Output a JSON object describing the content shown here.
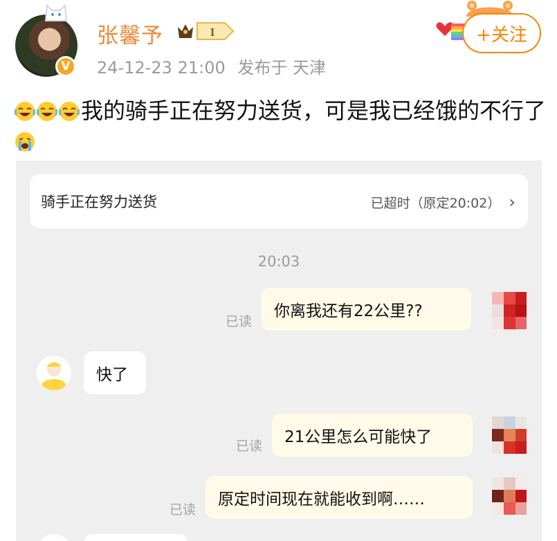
{
  "post": {
    "username": "张馨予",
    "member_level": "I",
    "timestamp": "24-12-23 21:00",
    "location": "发布于 天津",
    "follow_label": "+关注",
    "text": "我的骑手正在努力送货，可是我已经饿的不行了",
    "verified_mark": "V",
    "leading_emojis": [
      "laughing-crying-emoji",
      "laughing-crying-emoji",
      "laughing-crying-emoji"
    ],
    "trailing_emoji": "loud-crying-emoji",
    "colors": {
      "username": "#ee8a3a",
      "follow": "#ff8200",
      "meta": "#9a9a9a"
    }
  },
  "chat": {
    "status_title": "骑手正在努力送货",
    "status_detail": "已超时（原定20:02）",
    "chevron": "›",
    "time_divider": "20:03",
    "messages": [
      {
        "side": "right",
        "text": "你离我还有22公里??",
        "read": "已读"
      },
      {
        "side": "left",
        "text": "快了"
      },
      {
        "side": "right",
        "text": "21公里怎么可能快了",
        "read": "已读"
      },
      {
        "side": "right",
        "text": "原定时间现在就能收到啊……",
        "read": "已读"
      }
    ]
  }
}
